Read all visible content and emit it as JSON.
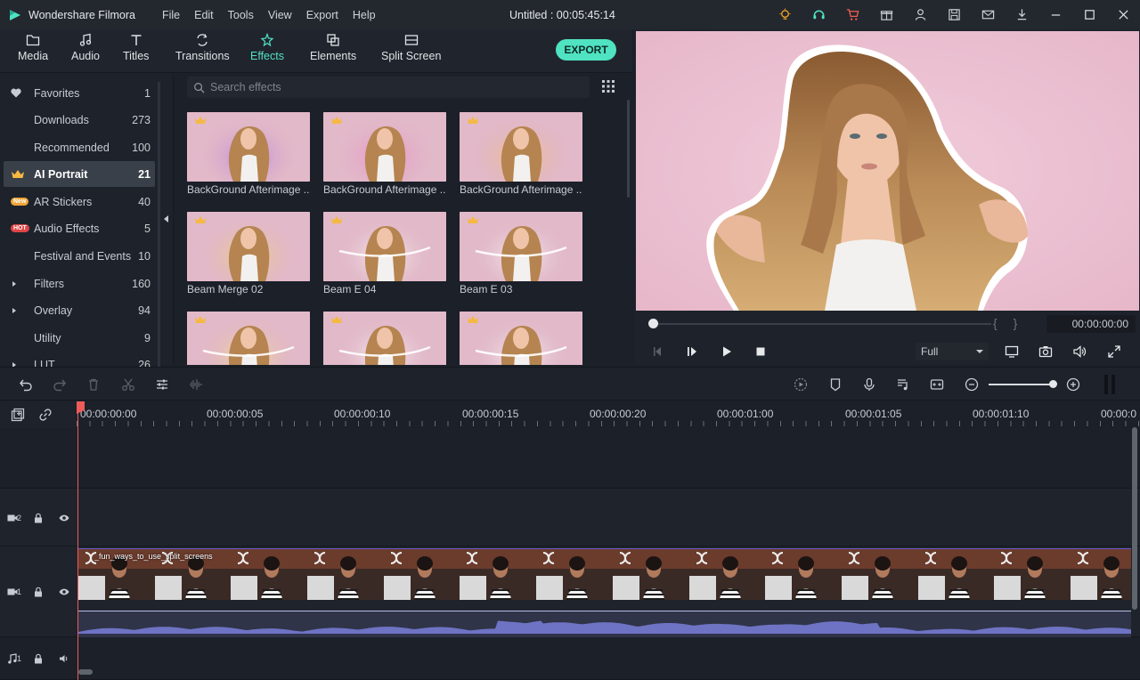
{
  "titlebar": {
    "app_name": "Wondershare Filmora",
    "menu": [
      "File",
      "Edit",
      "Tools",
      "View",
      "Export",
      "Help"
    ],
    "project_title": "Untitled : 00:05:45:14",
    "icons": [
      "bulb-icon",
      "headset-icon",
      "cart-icon",
      "gift-icon",
      "user-icon",
      "save-icon",
      "mail-icon",
      "download-icon",
      "minimize-icon",
      "maximize-icon",
      "close-icon"
    ],
    "accent_orange": "#f5a623",
    "accent_teal": "#4fe3c1"
  },
  "library_tabs": [
    {
      "label": "Media",
      "icon": "folder-icon",
      "active": false
    },
    {
      "label": "Audio",
      "icon": "music-icon",
      "active": false
    },
    {
      "label": "Titles",
      "icon": "title-icon",
      "active": false
    },
    {
      "label": "Transitions",
      "icon": "transitions-icon",
      "active": false
    },
    {
      "label": "Effects",
      "icon": "effects-icon",
      "active": true
    },
    {
      "label": "Elements",
      "icon": "elements-icon",
      "active": false
    },
    {
      "label": "Split Screen",
      "icon": "split-screen-icon",
      "active": false
    }
  ],
  "export_label": "EXPORT",
  "sidebar": {
    "items": [
      {
        "label": "Favorites",
        "count": "1",
        "lead": "heart"
      },
      {
        "label": "Downloads",
        "count": "273",
        "lead": ""
      },
      {
        "label": "Recommended",
        "count": "100",
        "lead": ""
      },
      {
        "label": "AI Portrait",
        "count": "21",
        "lead": "crown",
        "active": true
      },
      {
        "label": "AR Stickers",
        "count": "40",
        "lead": "new"
      },
      {
        "label": "Audio Effects",
        "count": "5",
        "lead": "hot"
      },
      {
        "label": "Festival and Events",
        "count": "10",
        "lead": ""
      },
      {
        "label": "Filters",
        "count": "160",
        "lead": "arrow"
      },
      {
        "label": "Overlay",
        "count": "94",
        "lead": "arrow"
      },
      {
        "label": "Utility",
        "count": "9",
        "lead": ""
      },
      {
        "label": "LUT",
        "count": "26",
        "lead": "arrow"
      }
    ],
    "badge_new": "New",
    "badge_hot": "HOT"
  },
  "search": {
    "placeholder": "Search effects"
  },
  "effects": [
    {
      "name": "BackGround Afterimage ...",
      "glow": "#b77ee8"
    },
    {
      "name": "BackGround Afterimage ...",
      "glow": "#f08ad0"
    },
    {
      "name": "BackGround Afterimage ...",
      "glow": "#f6c27a"
    },
    {
      "name": "Beam Merge 02",
      "glow": "#f2d77a"
    },
    {
      "name": "Beam E 04",
      "glow": "#ffffff"
    },
    {
      "name": "Beam E 03",
      "glow": "#ffffff"
    },
    {
      "name": "",
      "glow": "#f8e08a"
    },
    {
      "name": "",
      "glow": "#ffffff"
    },
    {
      "name": "",
      "glow": "#ffffff"
    }
  ],
  "preview": {
    "timecode": "00:00:00:00",
    "quality": "Full",
    "bg_color": "#ecc3d4"
  },
  "toolbar_icons": [
    "undo-icon",
    "redo-icon",
    "delete-icon",
    "cut-icon",
    "adjust-icon",
    "audio-wave-icon",
    "render-icon",
    "marker-icon",
    "mic-icon",
    "voiceover-icon",
    "fit-icon",
    "zoom-out-icon",
    "zoom-in-icon",
    "pause-icon"
  ],
  "timeline": {
    "ruler_labels": [
      "00:00:00:00",
      "00:00:00:05",
      "00:00:00:10",
      "00:00:00:15",
      "00:00:00:20",
      "00:00:01:00",
      "00:00:01:05",
      "00:00:01:10",
      "00:00:0"
    ],
    "tracks": [
      {
        "id": "2",
        "type": "video"
      },
      {
        "id": "1",
        "type": "video"
      },
      {
        "id": "1",
        "type": "audio"
      }
    ],
    "clip_name": "_fun_ways_to_use_split_screens",
    "clip_frames": 14
  }
}
